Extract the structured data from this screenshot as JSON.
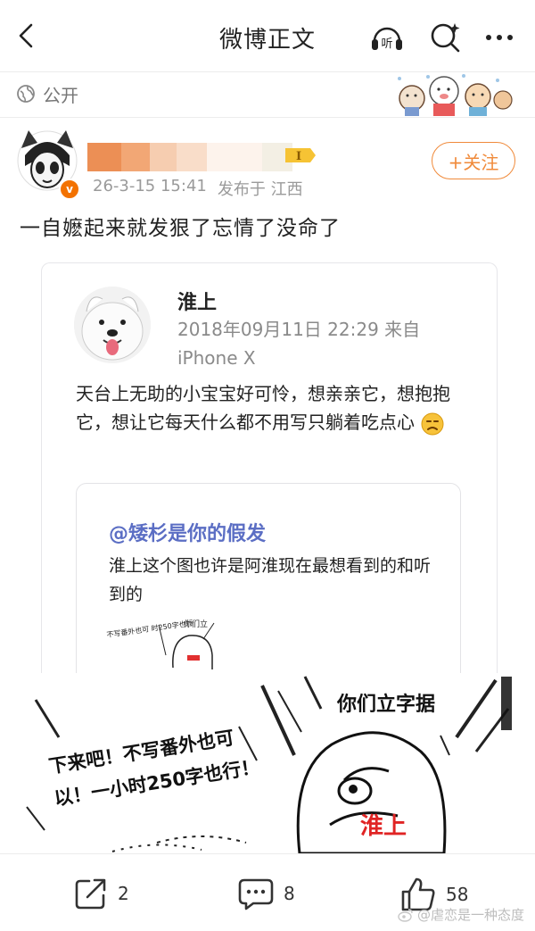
{
  "header": {
    "title": "微博正文"
  },
  "visibility": {
    "label": "公开"
  },
  "post": {
    "level_badge": "I",
    "time": "26-3-15 15:41",
    "location": "发布于 江西",
    "follow_label": "+关注",
    "text": "一自嬷起来就发狠了忘情了没命了"
  },
  "quoted": {
    "author": "淮上",
    "meta": "2018年09月11日 22:29 来自 iPhone X",
    "text": "天台上无助的小宝宝好可怜，想亲亲它，想抱抱它，想让它每天什么都不用写只躺着吃点心",
    "inner": {
      "mention": "@矮杉是你的假发",
      "text": "淮上这个图也许是阿淮现在最想看到的和听到的",
      "mini_left": "不写番外也可 时250字也行",
      "mini_right": "你们立"
    }
  },
  "comic": {
    "left_text_1": "下来吧！不写番外也可",
    "left_text_2": "以！一小时250字也行！",
    "right_text": "你们立字据",
    "label": "淮上"
  },
  "actions": {
    "share_count": "2",
    "comment_count": "8",
    "like_count": "58"
  },
  "watermark": "@虐恋是一种态度",
  "colors": {
    "accent": "#f08a3a",
    "mention": "#5b6ec4",
    "verified": "#f37200"
  }
}
